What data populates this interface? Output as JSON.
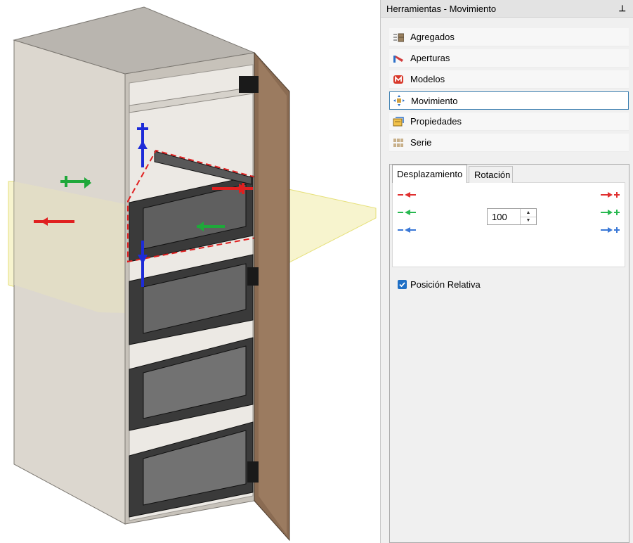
{
  "panel": {
    "title": "Herramientas - Movimiento",
    "pin_icon": "pin-icon"
  },
  "tools": [
    {
      "label": "Agregados",
      "icon": "agregados-icon"
    },
    {
      "label": "Aperturas",
      "icon": "aperturas-icon"
    },
    {
      "label": "Modelos",
      "icon": "modelos-icon"
    },
    {
      "label": "Movimiento",
      "icon": "movimiento-icon"
    },
    {
      "label": "Propiedades",
      "icon": "propiedades-icon"
    },
    {
      "label": "Serie",
      "icon": "serie-icon"
    }
  ],
  "tabs": {
    "desplazamiento": "Desplazamiento",
    "rotacion": "Rotación"
  },
  "movement": {
    "step_value": "100",
    "axis_colors": {
      "x": "#e03030",
      "y": "#28b850",
      "z": "#3a78d6"
    }
  },
  "options": {
    "relative_label": "Posición Relativa",
    "relative_checked": true
  }
}
